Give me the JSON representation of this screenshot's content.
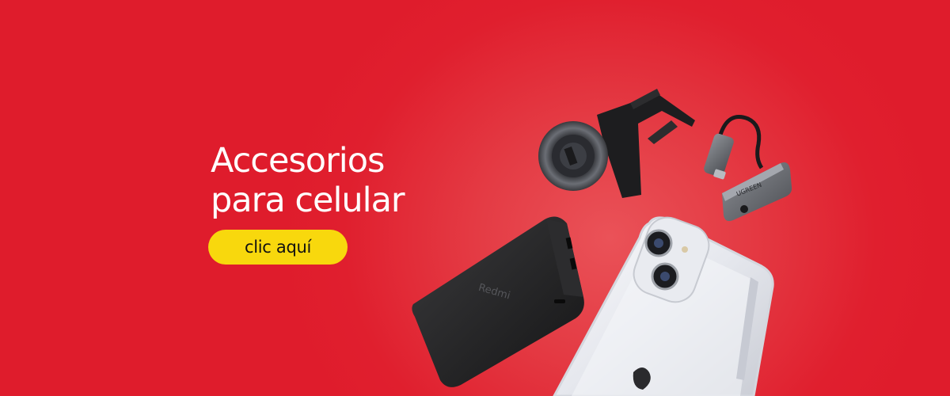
{
  "banner": {
    "headline_line1": "Accesorios",
    "headline_line2": "para celular",
    "cta_label": "clic aquí"
  },
  "products": {
    "powerbank_brand": "Redmi",
    "adapter_brand": "UGREEN"
  },
  "colors": {
    "background": "#e01f2e",
    "cta_background": "#f8d80d",
    "text": "#ffffff"
  },
  "icons": [
    "power-bank-image",
    "phone-case-image",
    "car-mount-image",
    "usb-c-audio-adapter-image"
  ]
}
